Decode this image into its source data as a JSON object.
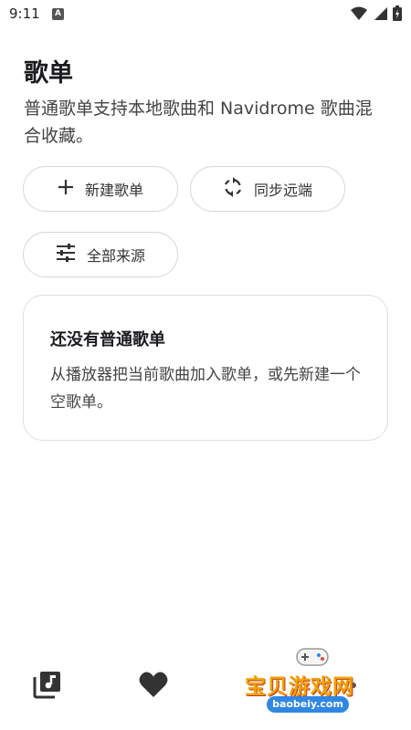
{
  "status_bar": {
    "time": "9:11",
    "notification_letter": "A"
  },
  "header": {
    "title": "歌单",
    "description": "普通歌单支持本地歌曲和 Navidrome 歌曲混合收藏。"
  },
  "actions": {
    "new_playlist_label": "新建歌单",
    "sync_remote_label": "同步远端",
    "all_sources_label": "全部来源"
  },
  "empty_state": {
    "title": "还没有普通歌单",
    "text": "从播放器把当前歌曲加入歌单，或先新建一个空歌单。"
  },
  "bottom_nav": {
    "items": [
      {
        "icon": "music-library-icon"
      },
      {
        "icon": "heart-icon"
      }
    ]
  },
  "watermark": {
    "text": "宝贝游戏网",
    "url": "baobeiy.com"
  },
  "colors": {
    "accent": "#1c1b1f",
    "border": "#d6d6d6",
    "watermark_orange": "#f2a100",
    "watermark_blue": "#2f87e3"
  }
}
